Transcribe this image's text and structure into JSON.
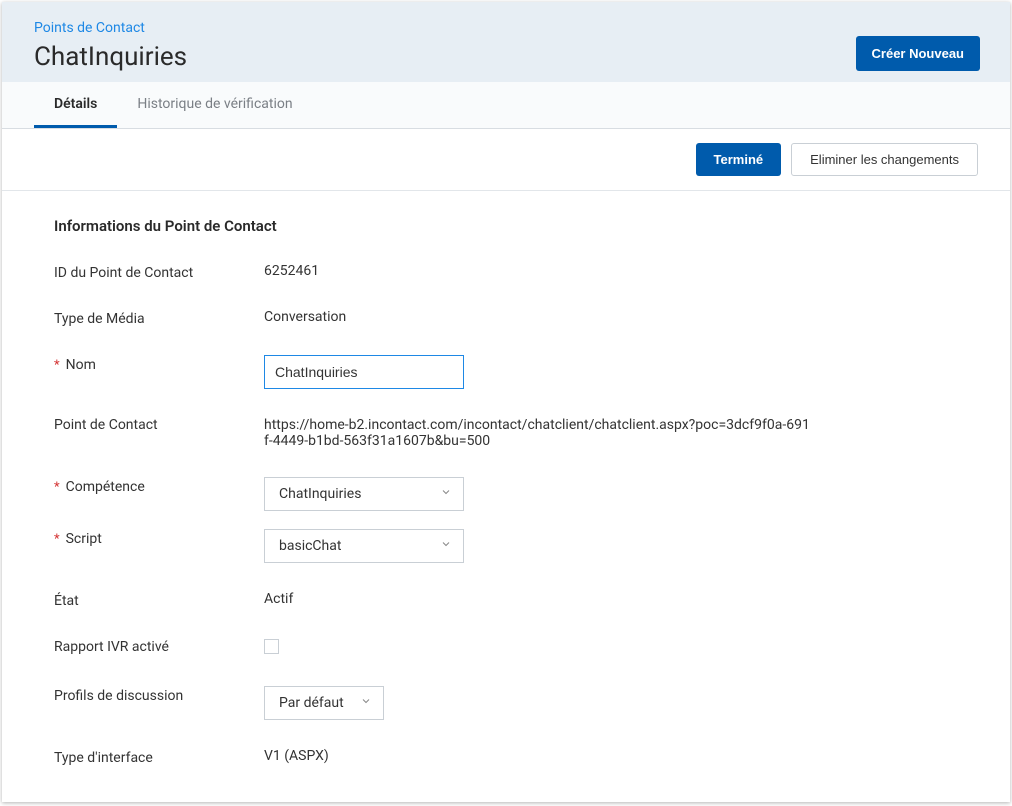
{
  "header": {
    "breadcrumb": "Points de Contact",
    "title": "ChatInquiries",
    "create_new_label": "Créer Nouveau"
  },
  "tabs": {
    "details": "Détails",
    "verification_history": "Historique de vérification"
  },
  "action_bar": {
    "done_label": "Terminé",
    "discard_label": "Eliminer les changements"
  },
  "section": {
    "title": "Informations du Point de Contact"
  },
  "fields": {
    "id_label": "ID du Point de Contact",
    "id_value": "6252461",
    "media_type_label": "Type de Média",
    "media_type_value": "Conversation",
    "name_label": "Nom",
    "name_value": "ChatInquiries",
    "poc_label": "Point de Contact",
    "poc_value": "https://home-b2.incontact.com/incontact/chatclient/chatclient.aspx?poc=3dcf9f0a-691f-4449-b1bd-563f31a1607b&bu=500",
    "skill_label": "Compétence",
    "skill_value": "ChatInquiries",
    "script_label": "Script",
    "script_value": "basicChat",
    "state_label": "État",
    "state_value": "Actif",
    "ivr_label": "Rapport IVR activé",
    "ivr_checked": false,
    "chat_profiles_label": "Profils de discussion",
    "chat_profiles_value": "Par défaut",
    "interface_type_label": "Type d'interface",
    "interface_type_value": "V1 (ASPX)"
  }
}
